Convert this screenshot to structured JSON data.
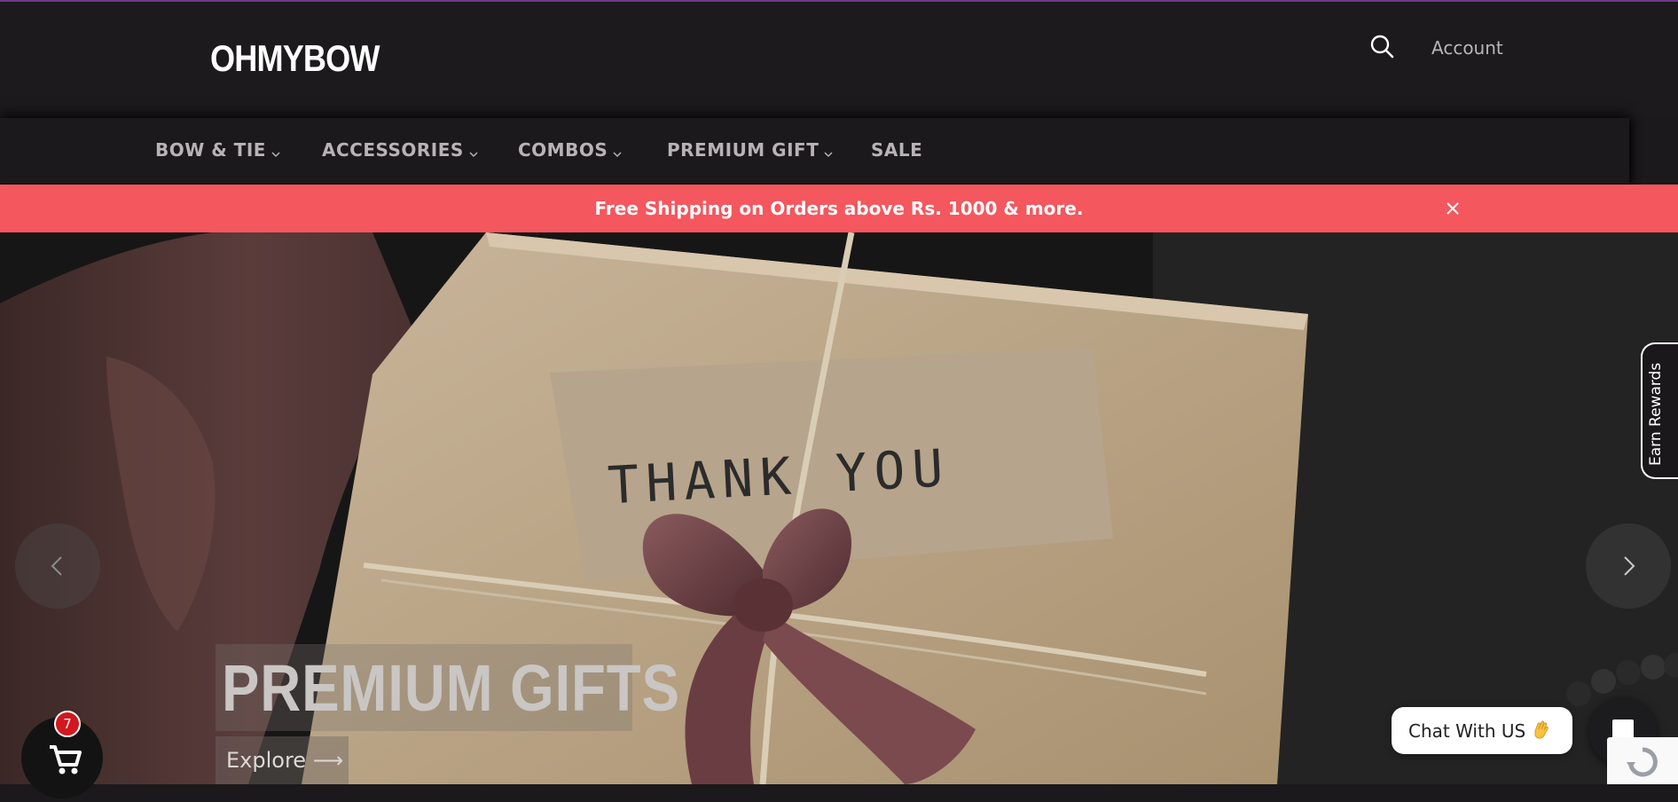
{
  "header": {
    "logo": "OHMYBOW",
    "account_label": "Account"
  },
  "nav": {
    "items": [
      {
        "label": "BOW & TIE",
        "has_dropdown": true
      },
      {
        "label": "ACCESSORIES",
        "has_dropdown": true
      },
      {
        "label": "COMBOS",
        "has_dropdown": true
      },
      {
        "label": "PREMIUM GIFT",
        "has_dropdown": true
      },
      {
        "label": "SALE",
        "has_dropdown": false
      }
    ]
  },
  "announcement": {
    "text": "Free Shipping on Orders above Rs. 1000 & more."
  },
  "hero": {
    "title": "PREMIUM GIFTS",
    "cta_label": "Explore ⟶",
    "tag_text": "THANK YOU"
  },
  "rewards": {
    "label": "Earn Rewards"
  },
  "chat": {
    "label": "Chat With US"
  },
  "cart": {
    "count": "7"
  },
  "colors": {
    "announcement_bg": "#f4575e",
    "header_bg": "#1c1a1c",
    "cart_badge": "#d3171e",
    "accent_line": "#6e3a8a"
  }
}
